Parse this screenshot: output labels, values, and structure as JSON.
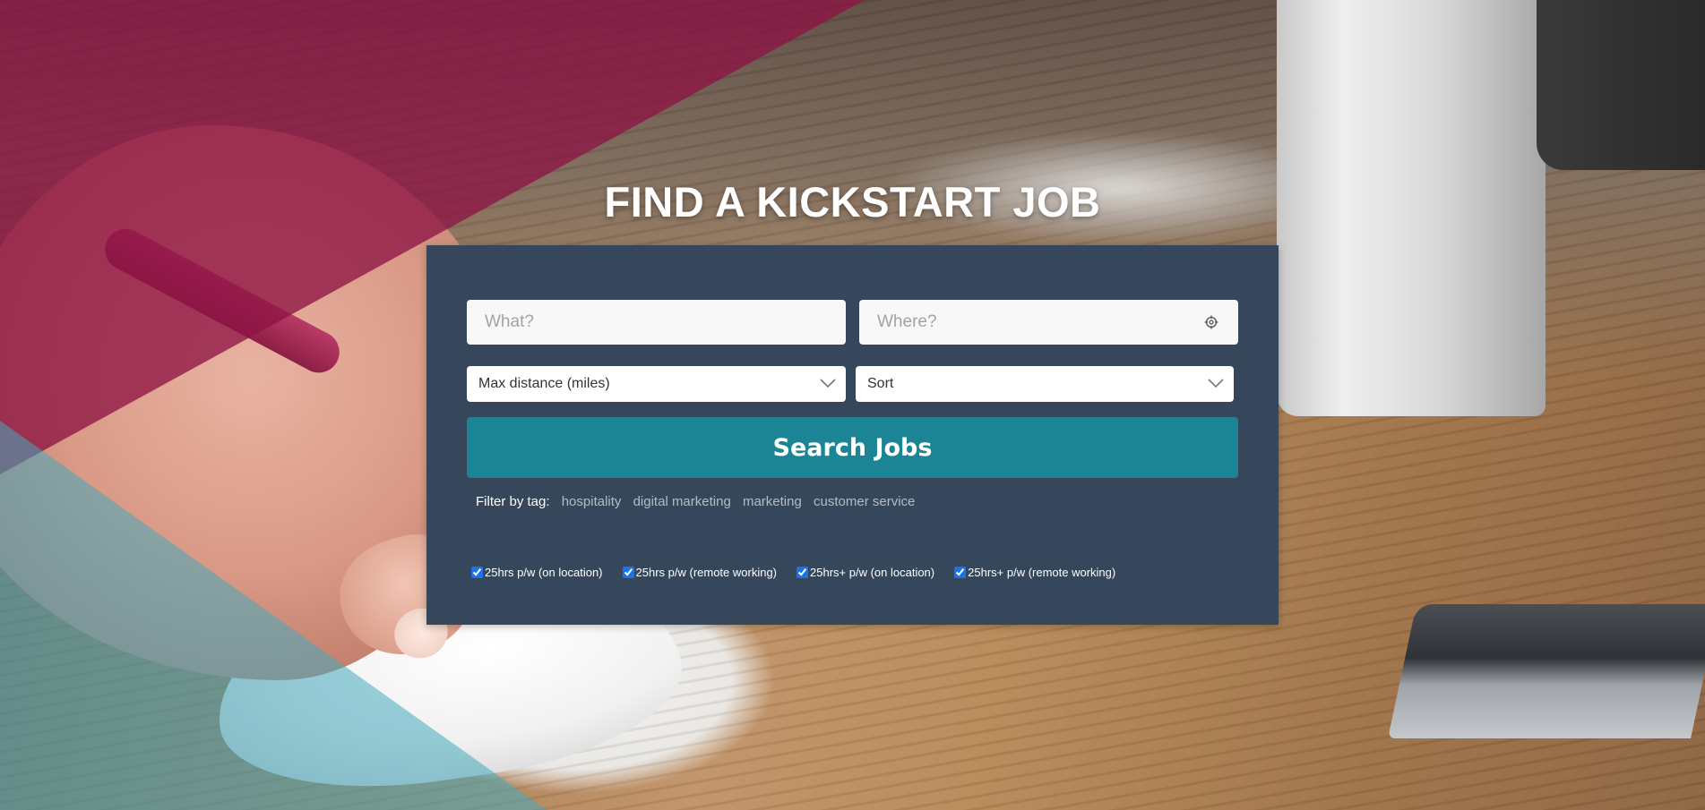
{
  "hero": {
    "title": "FIND A KICKSTART JOB"
  },
  "search": {
    "what_placeholder": "What?",
    "what_value": "",
    "where_placeholder": "Where?",
    "where_value": "",
    "locate_icon": "crosshair-icon",
    "distance_label": "Max distance (miles)",
    "sort_label": "Sort",
    "chevron_icon": "chevron-down-icon",
    "button_label": "Search Jobs"
  },
  "filters": {
    "tag_prefix": "Filter by tag:",
    "tags": [
      "hospitality",
      "digital marketing",
      "marketing",
      "customer service"
    ],
    "checkboxes": [
      {
        "label": "25hrs p/w (on location)",
        "checked": true
      },
      {
        "label": "25hrs p/w (remote working)",
        "checked": true
      },
      {
        "label": "25hrs+ p/w (on location)",
        "checked": true
      },
      {
        "label": "25hrs+ p/w (remote working)",
        "checked": true
      }
    ]
  },
  "colors": {
    "panel": "#37475b",
    "button": "#1b8495",
    "magenta_overlay": "#800e3e",
    "teal_overlay": "#46aabe"
  }
}
